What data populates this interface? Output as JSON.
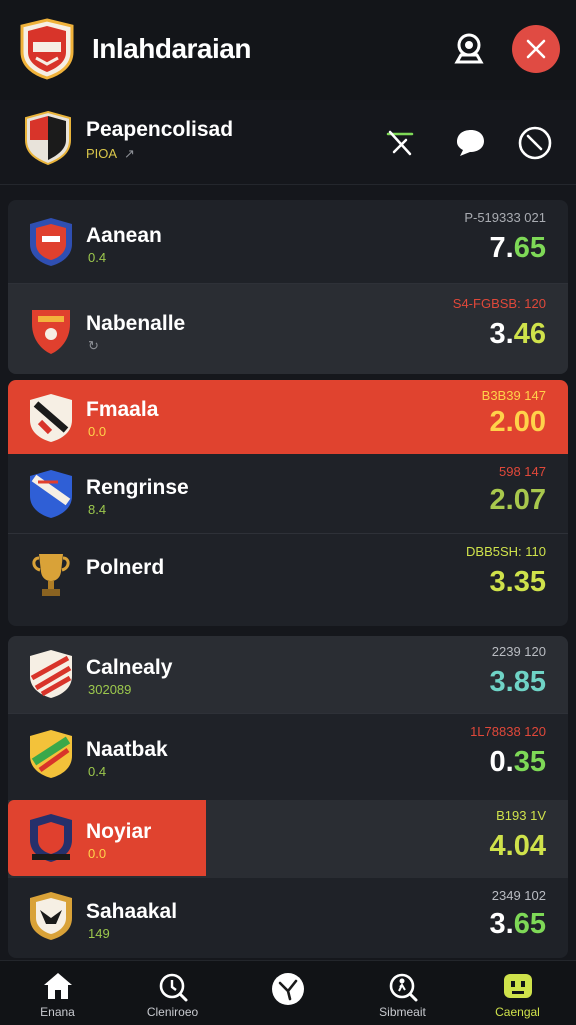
{
  "header": {
    "title": "Inlahdaraian",
    "profile_icon": "helmet-icon",
    "close_icon": "close-icon",
    "accent": "#e04b43"
  },
  "subheader": {
    "title": "Peapencolisad",
    "meta": "PIOA",
    "meta_arrow": "↗",
    "tools": [
      "no-signal-icon",
      "chat-bubble-icon",
      "stopwatch-icon"
    ]
  },
  "teams": [
    {
      "name": "Aanean",
      "meta": "0.4",
      "code": "P-519333 021",
      "odd_left": "7.",
      "odd_right": "65",
      "code_color": "#a9acb2",
      "meta_color": "#9cc84d",
      "left_color": "#ffffff",
      "right_color": "#7ed957"
    },
    {
      "name": "Nabenalle",
      "meta": "↻",
      "code": "S4-FGBSB: 120",
      "odd_left": "3.",
      "odd_right": "46",
      "code_color": "#e0483a",
      "meta_color": "#8d9096",
      "left_color": "#ffffff",
      "right_color": "#cfe24b"
    },
    {
      "name": "Fmaala",
      "meta": "0.0",
      "code": "B3B39 147",
      "odd_left": "2.",
      "odd_right": "00",
      "code_color": "#ffd24a",
      "meta_color": "#ffd24a",
      "left_color": "#ffd24a",
      "right_color": "#ffd24a"
    },
    {
      "name": "Rengrinse",
      "meta": "8.4",
      "code": "598 147",
      "odd_left": "2.",
      "odd_right": "07",
      "code_color": "#e0483a",
      "meta_color": "#9cc84d",
      "left_color": "#a9c84d",
      "right_color": "#a9c84d"
    },
    {
      "name": "Polnerd",
      "meta": "",
      "code": "DBB5SH: 110",
      "odd_left": "3.",
      "odd_right": "35",
      "code_color": "#cfe24b",
      "meta_color": "#9cc84d",
      "left_color": "#cfe24b",
      "right_color": "#cfe24b"
    },
    {
      "name": "Calnealy",
      "meta": "302089",
      "code": "2239 120",
      "odd_left": "3.",
      "odd_right": "85",
      "code_color": "#b9bcc2",
      "meta_color": "#9cc84d",
      "left_color": "#6fd3c6",
      "right_color": "#6fd3c6"
    },
    {
      "name": "Naatbak",
      "meta": "0.4",
      "code": "1L78838 120",
      "odd_left": "0.",
      "odd_right": "35",
      "code_color": "#e0483a",
      "meta_color": "#9cc84d",
      "left_color": "#ffffff",
      "right_color": "#7ed957"
    },
    {
      "name": "Noyiar",
      "meta": "0.0",
      "code": "B193 1V",
      "odd_left": "4.",
      "odd_right": "04",
      "code_color": "#cfe24b",
      "meta_color": "#ffd24a",
      "left_color": "#cfe24b",
      "right_color": "#cfe24b"
    },
    {
      "name": "Sahaakal",
      "meta": "149",
      "code": "2349 102",
      "odd_left": "3.",
      "odd_right": "65",
      "code_color": "#b9bcc2",
      "meta_color": "#9cc84d",
      "left_color": "#ffffff",
      "right_color": "#7ed957"
    }
  ],
  "nav": [
    {
      "label": "Enana",
      "icon": "home-icon"
    },
    {
      "label": "Cleniroeo",
      "icon": "search-icon"
    },
    {
      "label": "",
      "icon": "ball-icon"
    },
    {
      "label": "Sibmeait",
      "icon": "runner-search-icon"
    },
    {
      "label": "Caengal",
      "icon": "mascot-icon"
    }
  ],
  "colors": {
    "background": "#15171c",
    "panel": "#1f2228",
    "highlight": "#e0432f",
    "active_nav": "#cfe24b"
  }
}
